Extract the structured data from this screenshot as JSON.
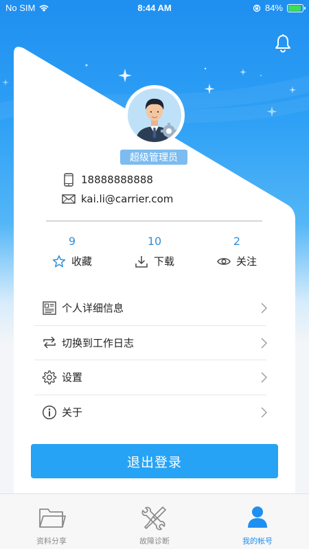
{
  "status_bar": {
    "carrier": "No SIM",
    "time": "8:44 AM",
    "battery": "84%",
    "battery_level": 0.84
  },
  "profile": {
    "role": "超级管理员",
    "phone": "18888888888",
    "email": "kai.li@carrier.com"
  },
  "stats": [
    {
      "count": "9",
      "label": "收藏",
      "icon": "star-icon"
    },
    {
      "count": "10",
      "label": "下载",
      "icon": "download-icon"
    },
    {
      "count": "2",
      "label": "关注",
      "icon": "eye-icon"
    }
  ],
  "menu": [
    {
      "label": "个人详细信息",
      "icon": "newspaper-icon"
    },
    {
      "label": "切换到工作日志",
      "icon": "switch-arrows-icon"
    },
    {
      "label": "设置",
      "icon": "gear-icon"
    },
    {
      "label": "关于",
      "icon": "info-icon"
    }
  ],
  "logout_label": "退出登录",
  "tabs": [
    {
      "label": "资料分享",
      "icon": "folder-icon",
      "active": false
    },
    {
      "label": "故障诊断",
      "icon": "tools-icon",
      "active": false
    },
    {
      "label": "我的帐号",
      "icon": "person-icon",
      "active": true
    }
  ],
  "colors": {
    "accent": "#1f8ff0",
    "button": "#27a3f5",
    "stat_number": "#2f8ed8"
  }
}
